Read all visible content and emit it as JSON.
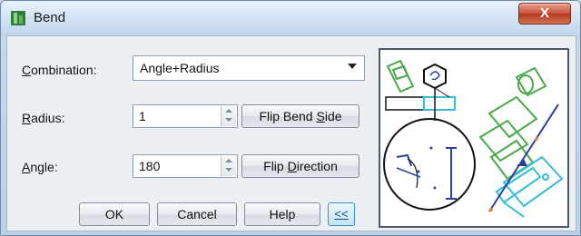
{
  "window": {
    "title": "Bend",
    "close_label": "X",
    "accent": "#3b8fc7"
  },
  "form": {
    "combination": {
      "label_accel": "C",
      "label_rest": "ombination:",
      "value": "Angle+Radius"
    },
    "radius": {
      "label_accel": "R",
      "label_rest": "adius:",
      "value": "1"
    },
    "angle": {
      "label_accel": "A",
      "label_rest": "ngle:",
      "value": "180"
    },
    "flip_bend_side": {
      "pre": "Flip Bend ",
      "accel": "S",
      "post": "ide"
    },
    "flip_direction": {
      "pre": "Flip ",
      "accel": "D",
      "post": "irection"
    }
  },
  "buttons": {
    "ok": "OK",
    "cancel": "Cancel",
    "help": "Help",
    "collapse": "<<"
  },
  "preview": {
    "icon": "bend-preview-diagram",
    "colors": {
      "green": "#4aa84a",
      "cyan": "#36bcd6",
      "blue": "#2a3f9e",
      "black": "#111111"
    }
  }
}
